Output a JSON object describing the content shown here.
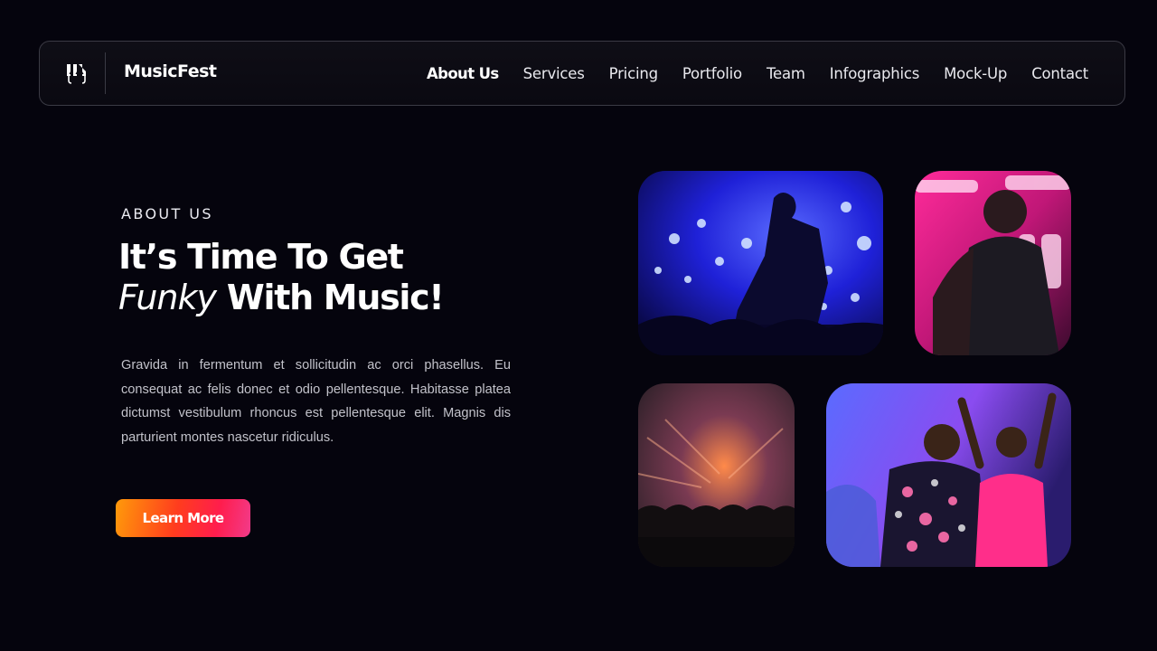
{
  "header": {
    "brand": "MusicFest",
    "logo_icon": "music-quote-icon",
    "nav": [
      {
        "label": "About Us",
        "active": true
      },
      {
        "label": "Services",
        "active": false
      },
      {
        "label": "Pricing",
        "active": false
      },
      {
        "label": "Portfolio",
        "active": false
      },
      {
        "label": "Team",
        "active": false
      },
      {
        "label": "Infographics",
        "active": false
      },
      {
        "label": "Mock-Up",
        "active": false
      },
      {
        "label": "Contact",
        "active": false
      }
    ]
  },
  "hero": {
    "eyebrow": "ABOUT US",
    "headline_line1": "It’s Time To Get",
    "headline_italic": "Funky",
    "headline_rest": " With Music!",
    "body": "Gravida in fermentum et sollicitudin ac orci phasellus. Eu consequat ac felis donec et odio pellentesque. Habitasse platea dictumst vestibulum rhoncus est pellentesque elit. Magnis dis parturient montes nascetur ridiculus.",
    "cta_label": "Learn More"
  },
  "colors": {
    "background": "#05040d",
    "cta_gradient_start": "#ff9a0a",
    "cta_gradient_end": "#f23b8a",
    "text_muted": "#c2c2ca"
  }
}
